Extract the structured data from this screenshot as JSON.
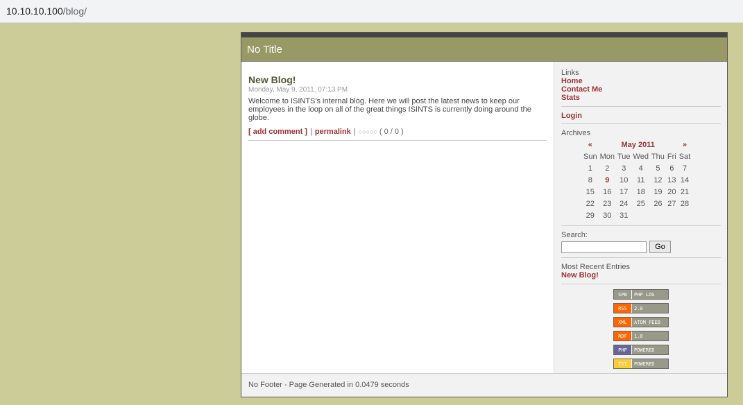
{
  "browser": {
    "url_host": "10.10.10.100",
    "url_path": "/blog/"
  },
  "blog": {
    "title": "No Title",
    "footer": "No Footer - Page Generated in 0.0479 seconds"
  },
  "entry": {
    "title": "New Blog!",
    "date": "Monday, May 9, 2011, 07:13 PM",
    "body": "Welcome to ISINTS's internal blog. Here we will post the latest news to keep our employees in the loop on all of the great things ISINTS is currently doing around the globe.",
    "add_comment": "[ add comment ]",
    "permalink": "permalink",
    "stars": "○○○○○",
    "rating": "( 0 / 0 )",
    "separator": "|"
  },
  "sidebar": {
    "links_label": "Links",
    "links": [
      "Home",
      "Contact Me",
      "Stats"
    ],
    "login": "Login",
    "archives_label": "Archives",
    "calendar": {
      "prev": "«",
      "month": "May 2011",
      "next": "»",
      "weekdays": [
        "Sun",
        "Mon",
        "Tue",
        "Wed",
        "Thu",
        "Fri",
        "Sat"
      ],
      "weeks": [
        [
          "1",
          "2",
          "3",
          "4",
          "5",
          "6",
          "7"
        ],
        [
          "8",
          "9",
          "10",
          "11",
          "12",
          "13",
          "14"
        ],
        [
          "15",
          "16",
          "17",
          "18",
          "19",
          "20",
          "21"
        ],
        [
          "22",
          "23",
          "24",
          "25",
          "26",
          "27",
          "28"
        ],
        [
          "29",
          "30",
          "31",
          "",
          "",
          "",
          ""
        ]
      ],
      "highlighted": "9"
    },
    "search_label": "Search:",
    "search_value": "",
    "go_label": "Go",
    "recent_label": "Most Recent Entries",
    "recent_entries": [
      "New Blog!"
    ],
    "badges": [
      {
        "left": "SPB",
        "right": "PHP LOG",
        "color": "#999988"
      },
      {
        "left": "RSS",
        "right": "2.0",
        "color": "#ff6600"
      },
      {
        "left": "XML",
        "right": "ATOM FEED",
        "color": "#ff6600"
      },
      {
        "left": "RDF",
        "right": "1.0",
        "color": "#ff6600"
      },
      {
        "left": "PHP",
        "right": "POWERED",
        "color": "#666699"
      },
      {
        "left": "TXT",
        "right": "POWERED",
        "color": "#ffcc33"
      }
    ]
  },
  "colors": {
    "background": "#cccc99",
    "header": "#999966",
    "link": "#993333"
  }
}
